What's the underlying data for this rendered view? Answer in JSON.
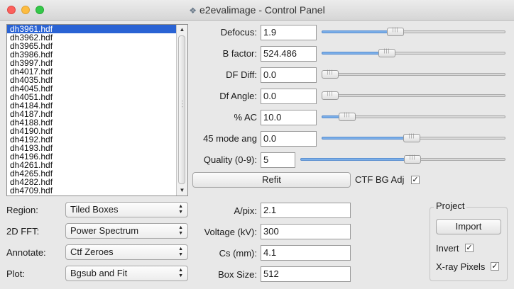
{
  "window": {
    "title": "e2evalimage - Control Panel",
    "title_icon": "app-icon"
  },
  "file_list": {
    "items": [
      "dh3961.hdf",
      "dh3962.hdf",
      "dh3965.hdf",
      "dh3986.hdf",
      "dh3997.hdf",
      "dh4017.hdf",
      "dh4035.hdf",
      "dh4045.hdf",
      "dh4051.hdf",
      "dh4184.hdf",
      "dh4187.hdf",
      "dh4188.hdf",
      "dh4190.hdf",
      "dh4192.hdf",
      "dh4193.hdf",
      "dh4196.hdf",
      "dh4261.hdf",
      "dh4265.hdf",
      "dh4282.hdf",
      "dh4709.hdf"
    ],
    "selected_index": 0
  },
  "params": [
    {
      "label": "Defocus:",
      "value": "1.9",
      "slider_fraction": 0.39
    },
    {
      "label": "B factor:",
      "value": "524.486",
      "slider_fraction": 0.34
    },
    {
      "label": "DF Diff:",
      "value": "0.0",
      "slider_fraction": 0.0
    },
    {
      "label": "Df Angle:",
      "value": "0.0",
      "slider_fraction": 0.0
    },
    {
      "label": "% AC",
      "value": "10.0",
      "slider_fraction": 0.1
    },
    {
      "label": "45 mode ang",
      "value": "0.0",
      "slider_fraction": 0.49
    },
    {
      "label": "Quality (0-9):",
      "value": "5",
      "slider_fraction": 0.55
    }
  ],
  "refit_button": "Refit",
  "ctf_bg_adj": {
    "label": "CTF BG Adj",
    "checked": true
  },
  "combos": [
    {
      "label": "Region:",
      "value": "Tiled Boxes"
    },
    {
      "label": "2D FFT:",
      "value": "Power Spectrum"
    },
    {
      "label": "Annotate:",
      "value": "Ctf Zeroes"
    },
    {
      "label": "Plot:",
      "value": "Bgsub and Fit"
    }
  ],
  "settings": [
    {
      "label": "A/pix:",
      "value": "2.1"
    },
    {
      "label": "Voltage (kV):",
      "value": "300"
    },
    {
      "label": "Cs (mm):",
      "value": "4.1"
    },
    {
      "label": "Box Size:",
      "value": "512"
    }
  ],
  "project": {
    "title": "Project",
    "import_button": "Import",
    "invert": {
      "label": "Invert",
      "checked": true
    },
    "xray": {
      "label": "X-ray Pixels",
      "checked": true
    }
  },
  "colors": {
    "selection": "#2a63d4",
    "slider_fill": "#7aaee8"
  }
}
